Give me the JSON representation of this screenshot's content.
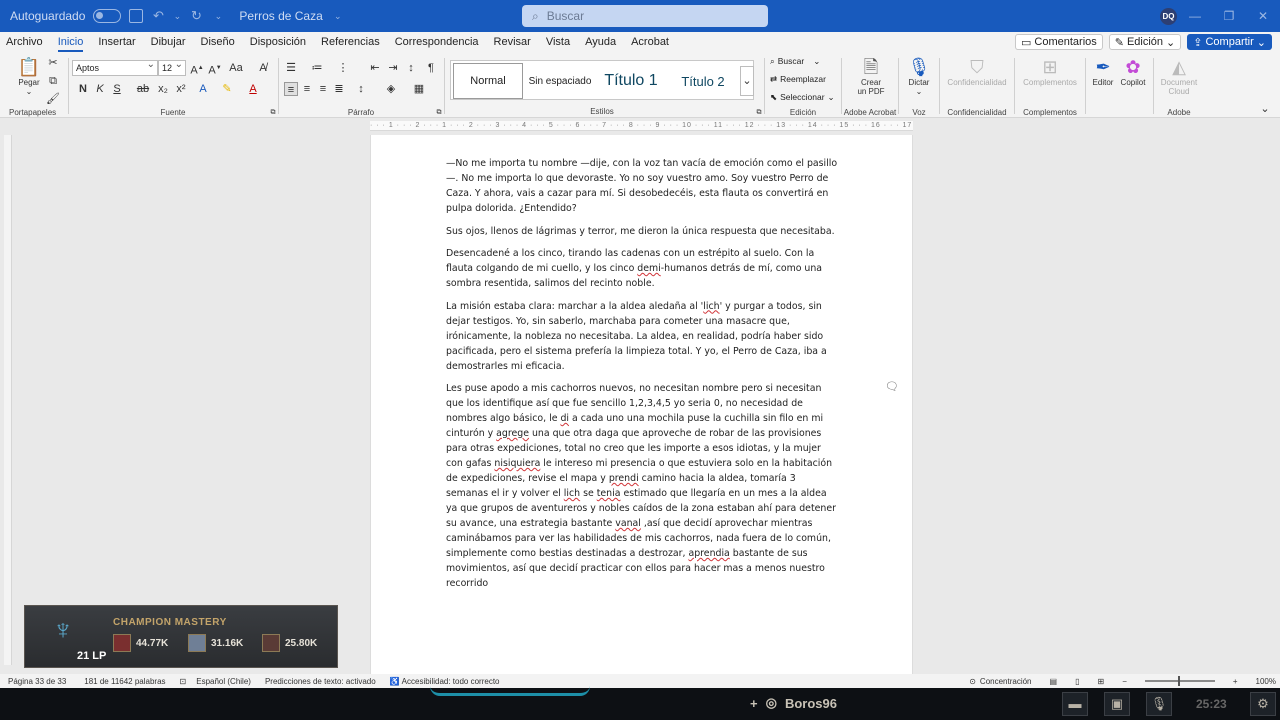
{
  "titlebar": {
    "autosave_label": "Autoguardado",
    "doc_name": "Perros de Caza",
    "search_placeholder": "Buscar",
    "user_initials": "DQ"
  },
  "menu": {
    "tabs": [
      "Archivo",
      "Inicio",
      "Insertar",
      "Dibujar",
      "Diseño",
      "Disposición",
      "Referencias",
      "Correspondencia",
      "Revisar",
      "Vista",
      "Ayuda",
      "Acrobat"
    ],
    "active_tab": "Inicio",
    "comments_label": "Comentarios",
    "editing_label": "Edición",
    "share_label": "Compartir"
  },
  "ribbon": {
    "clipboard": {
      "paste_label": "Pegar",
      "group_label": "Portapapeles"
    },
    "font": {
      "family": "Aptos",
      "size": "12",
      "group_label": "Fuente"
    },
    "paragraph": {
      "group_label": "Párrafo"
    },
    "styles": {
      "group_label": "Estilos",
      "items": [
        "Normal",
        "Sin espaciado",
        "Título 1",
        "Título 2"
      ]
    },
    "editing": {
      "group_label": "Edición",
      "find_label": "Buscar",
      "replace_label": "Reemplazar",
      "select_label": "Seleccionar"
    },
    "adobe_acrobat": {
      "create_pdf_line1": "Crear",
      "create_pdf_line2": "un PDF",
      "group_label": "Adobe Acrobat"
    },
    "voice": {
      "dictate_label": "Dictar",
      "group_label": "Voz"
    },
    "sensitivity": {
      "button_label": "Confidencialidad",
      "group_label": "Confidencialidad"
    },
    "addins": {
      "button_label": "Complementos",
      "group_label": "Complementos"
    },
    "editor_label": "Editor",
    "copilot_label": "Copilot",
    "adobe": {
      "doc_cloud_line1": "Document",
      "doc_cloud_line2": "Cloud",
      "group_label": "Adobe"
    }
  },
  "document": {
    "p1": "—No me importa tu nombre —dije, con la voz tan vacía de emoción como el pasillo—. No me importa lo que devoraste. Yo no soy vuestro amo. Soy vuestro Perro de Caza. Y ahora, vais a cazar para mí. Si desobedecéis, esta flauta os convertirá en pulpa dolorida. ¿Entendido?",
    "p2": "Sus ojos, llenos de lágrimas y terror, me dieron la única respuesta que necesitaba.",
    "p3": {
      "a": "Desencadené a los cinco, tirando las cadenas con un estrépito al suelo. Con la flauta colgando de mi cuello, y los cinco ",
      "b": "demi",
      "c": "-humanos detrás de mí, como una sombra resentida, salimos del recinto noble."
    },
    "p4": {
      "a": "La misión estaba clara: marchar a la aldea aledaña al '",
      "b": "lich",
      "c": "' y purgar a todos, sin dejar testigos. Yo, sin saberlo, marchaba para cometer una masacre que, irónicamente, la nobleza no necesitaba. La aldea, en realidad, podría haber sido pacificada, pero el sistema prefería la limpieza total. Y yo, el Perro de Caza, iba a demostrarles mi eficacia."
    },
    "p5": {
      "a": "Les puse apodo a mis cachorros nuevos, no necesitan nombre pero si necesitan que los identifique así que fue sencillo 1,2,3,4,5 yo seria 0, no necesidad de nombres algo básico, le ",
      "b": "di",
      "c": " a cada uno una mochila puse la cuchilla sin filo en mi cinturón y ",
      "d": "agrege",
      "e": " una que otra daga que aproveche de robar de las provisiones para otras expediciones, total no creo que les importe a esos idiotas, y la mujer con gafas ",
      "f": "nisiquiera",
      "g": " le intereso mi presencia o que estuviera solo en la habitación de expediciones, revise el mapa y ",
      "h": "prendi",
      "i": " camino hacia la aldea, tomaría 3 semanas el ir y volver el ",
      "j": "lich",
      "k": " se ",
      "l": "tenia",
      "m": " estimado que llegaría en un mes a la aldea ya que grupos de aventureros y nobles caídos de la zona estaban ahí para detener su avance, una estrategia bastante ",
      "n": "vanal",
      "o": " ,así que decidí aprovechar mientras caminábamos para ver las habilidades de mis cachorros, nada fuera de lo común, simplemente como bestias destinadas a destrozar, ",
      "p": "aprendia",
      "q": " bastante de sus movimientos, así que decidí practicar con ellos para hacer mas a menos nuestro recorrido"
    }
  },
  "overlay": {
    "title": "CHAMPION MASTERY",
    "lp": "21 LP",
    "champions": [
      "44.77K",
      "31.16K",
      "25.80K"
    ]
  },
  "statusbar": {
    "page": "Página 33 de 33",
    "words": "181 de 11642 palabras",
    "language": "Español (Chile)",
    "predictions": "Predicciones de texto: activado",
    "accessibility": "Accesibilidad: todo correcto",
    "focus": "Concentración",
    "zoom": "100%"
  },
  "taskbar": {
    "player_name": "Boros96",
    "time": "25:23"
  },
  "colors": {
    "title_blue": "#185abd",
    "spell_underline": "#d13438",
    "ribbon_bg": "#f3f3f3"
  }
}
